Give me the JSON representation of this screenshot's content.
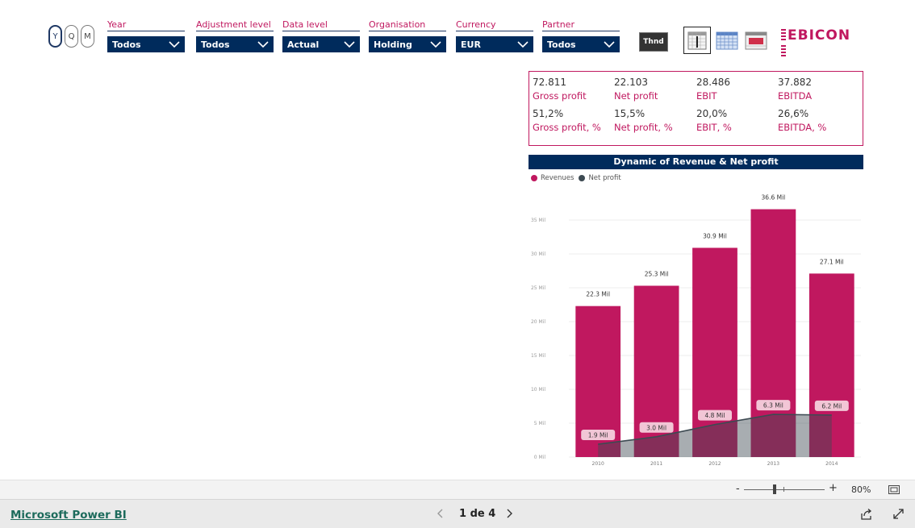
{
  "period_toggles": [
    {
      "label": "Y",
      "active": true
    },
    {
      "label": "Q",
      "active": false
    },
    {
      "label": "M",
      "active": false
    }
  ],
  "slicers": [
    {
      "label": "Year",
      "value": "Todos"
    },
    {
      "label": "Adjustment level",
      "value": "Todos"
    },
    {
      "label": "Data level",
      "value": "Actual"
    },
    {
      "label": "Organisation",
      "value": "Holding"
    },
    {
      "label": "Currency",
      "value": "EUR"
    },
    {
      "label": "Partner",
      "value": "Todos"
    }
  ],
  "thnd_button": "Thnd",
  "logo_text": "EBICON",
  "kpis": [
    {
      "value": "72.811",
      "label": "Gross profit"
    },
    {
      "value": "22.103",
      "label": "Net profit"
    },
    {
      "value": "28.486",
      "label": "EBIT"
    },
    {
      "value": "37.882",
      "label": "EBITDA"
    },
    {
      "value": "51,2%",
      "label": "Gross profit, %"
    },
    {
      "value": "15,5%",
      "label": "Net profit, %"
    },
    {
      "value": "20,0%",
      "label": "EBIT, %"
    },
    {
      "value": "26,6%",
      "label": "EBITDA, %"
    }
  ],
  "chart_title": "Dynamic of Revenue & Net profit",
  "chart_data": {
    "type": "bar",
    "title": "Dynamic of Revenue & Net profit",
    "categories": [
      "2010",
      "2011",
      "2012",
      "2013",
      "2014"
    ],
    "series": [
      {
        "name": "Revenues",
        "type": "bar",
        "values": [
          22.3,
          25.3,
          30.9,
          36.6,
          27.1
        ],
        "labels": [
          "22.3 Mil",
          "25.3 Mil",
          "30.9 Mil",
          "36.6 Mil",
          "27.1 Mil"
        ],
        "color": "#c0185f"
      },
      {
        "name": "Net profit",
        "type": "area",
        "values": [
          1.9,
          3.0,
          4.8,
          6.3,
          6.2
        ],
        "labels": [
          "1.9 Mil",
          "3.0 Mil",
          "4.8 Mil",
          "6.3 Mil",
          "6.2 Mil"
        ],
        "color": "#3d4a52"
      }
    ],
    "y_ticks": [
      "0 Mil",
      "5 Mil",
      "10 Mil",
      "15 Mil",
      "20 Mil",
      "25 Mil",
      "30 Mil",
      "35 Mil"
    ],
    "y_tick_values": [
      0,
      5,
      10,
      15,
      20,
      25,
      30,
      35
    ],
    "ylim": [
      0,
      37.5
    ],
    "grid": true,
    "legend_position": "top-left"
  },
  "zoom": {
    "minus": "-",
    "plus": "+",
    "level": "80%"
  },
  "footer": {
    "brand": "Microsoft Power BI",
    "page_indicator": "1 de 4"
  },
  "colors": {
    "accent": "#c0185f",
    "navy": "#002b5c",
    "area": "#3d4a52"
  }
}
